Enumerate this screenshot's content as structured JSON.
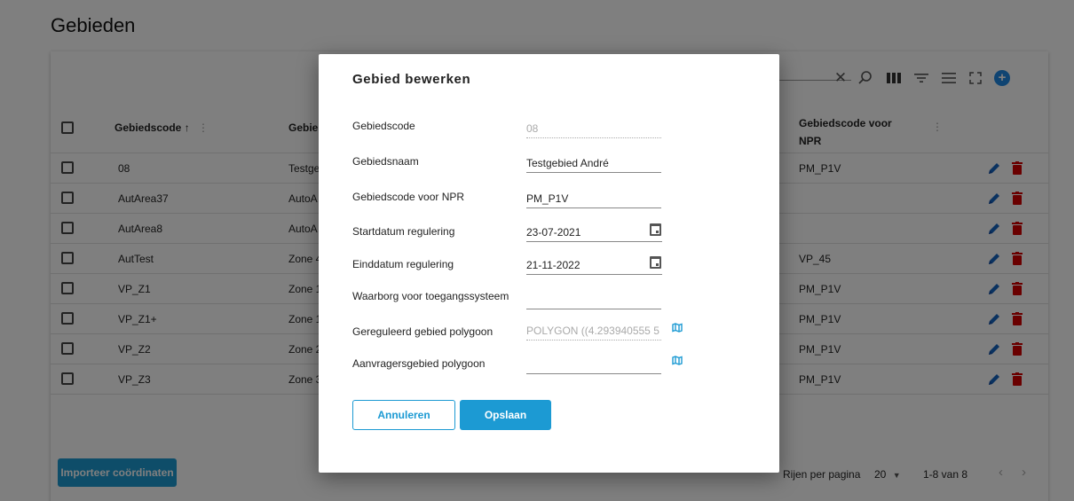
{
  "page": {
    "title": "Gebieden"
  },
  "table": {
    "columns": {
      "code": "Gebiedscode",
      "sort_indicator": "↑",
      "name_partial": "Gebie",
      "npr_line1": "Gebiedscode voor",
      "npr_line2": "NPR"
    },
    "rows": [
      {
        "code": "08",
        "name": "Testge",
        "npr": "PM_P1V"
      },
      {
        "code": "AutArea37",
        "name": "AutoA",
        "npr": ""
      },
      {
        "code": "AutArea8",
        "name": "AutoA",
        "npr": ""
      },
      {
        "code": "AutTest",
        "name": "Zone 4",
        "npr": "VP_45"
      },
      {
        "code": "VP_Z1",
        "name": "Zone 1",
        "npr": "PM_P1V"
      },
      {
        "code": "VP_Z1+",
        "name": "Zone 1",
        "npr": "PM_P1V"
      },
      {
        "code": "VP_Z2",
        "name": "Zone 2",
        "npr": "PM_P1V"
      },
      {
        "code": "VP_Z3",
        "name": "Zone 3",
        "npr": "PM_P1V"
      }
    ]
  },
  "footer": {
    "import_label": "Importeer coördinaten",
    "rows_per_page_label": "Rijen per pagina",
    "rows_per_page_value": "20",
    "range_label": "1-8 van 8"
  },
  "toolbar": {
    "icons": [
      "clear-icon",
      "search-icon",
      "columns-icon",
      "filter-icon",
      "density-icon",
      "fullscreen-icon",
      "add-icon"
    ]
  },
  "modal": {
    "title": "Gebied bewerken",
    "fields": {
      "code": {
        "label": "Gebiedscode",
        "value": "08"
      },
      "name": {
        "label": "Gebiedsnaam",
        "value": "Testgebied André"
      },
      "npr": {
        "label": "Gebiedscode voor NPR",
        "value": "PM_P1V"
      },
      "start": {
        "label": "Startdatum regulering",
        "value": "23-07-2021"
      },
      "end": {
        "label": "Einddatum regulering",
        "value": "21-11-2022"
      },
      "deposit": {
        "label": "Waarborg voor toegangssysteem",
        "value": ""
      },
      "polygon": {
        "label": "Gereguleerd gebied polygoon",
        "value": "POLYGON ((4.293940555 5"
      },
      "applicant_polygon": {
        "label": "Aanvragersgebied polygoon",
        "value": ""
      }
    },
    "cancel_label": "Annuleren",
    "save_label": "Opslaan"
  },
  "colors": {
    "accent": "#1c9ad3",
    "edit": "#1565c0",
    "delete": "#d50000",
    "add": "#1e88e5"
  }
}
